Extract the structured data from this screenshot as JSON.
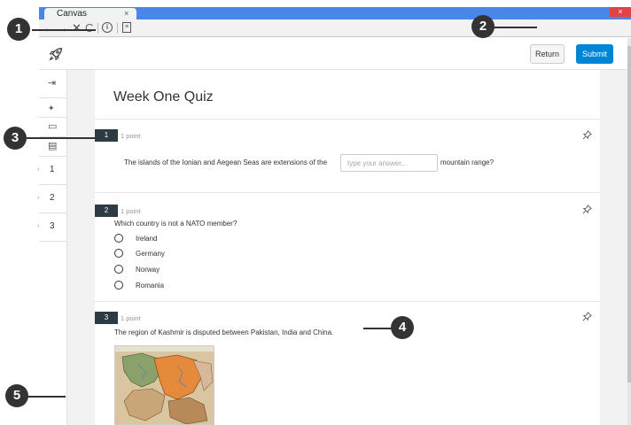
{
  "browser": {
    "tab_title": "Canvas",
    "tab_close": "×",
    "window_close": "×",
    "back": "←",
    "forward": "→",
    "stop": "✕",
    "reload": "C",
    "info": "i",
    "page": "≡"
  },
  "app_bar": {
    "return_label": "Return",
    "submit_label": "Submit",
    "logo_icon": "rocket-icon"
  },
  "rail": {
    "icons": [
      "collapse-arrow-icon",
      "pin-icon",
      "calculator-icon",
      "notes-icon"
    ],
    "collapse_glyph": "⇥",
    "pin_glyph": "✦",
    "calculator_glyph": "▭",
    "notes_glyph": "▤",
    "caret_glyph": "›",
    "question_numbers": [
      "1",
      "2",
      "3"
    ]
  },
  "quiz": {
    "title": "Week One Quiz",
    "questions": [
      {
        "number": "1",
        "points": "1 point",
        "text_before": "The islands of the Ionian and Aegean Seas are extensions of the",
        "placeholder": "type your answer...",
        "text_after": "mountain range?"
      },
      {
        "number": "2",
        "points": "1 point",
        "text": "Which country is not a NATO member?",
        "options": [
          "Ireland",
          "Germany",
          "Norway",
          "Romania"
        ]
      },
      {
        "number": "3",
        "points": "1 point",
        "text": "The region of Kashmir is disputed between Pakistan, India and China.",
        "image_icon": "kashmir-map-image"
      }
    ]
  },
  "callouts": [
    "1",
    "2",
    "3",
    "4",
    "5"
  ],
  "colors": {
    "browser_blue": "#4a86e8",
    "submit_blue": "#0084d6",
    "badge_dark": "#2d3b45",
    "callout_dark": "#333333"
  }
}
